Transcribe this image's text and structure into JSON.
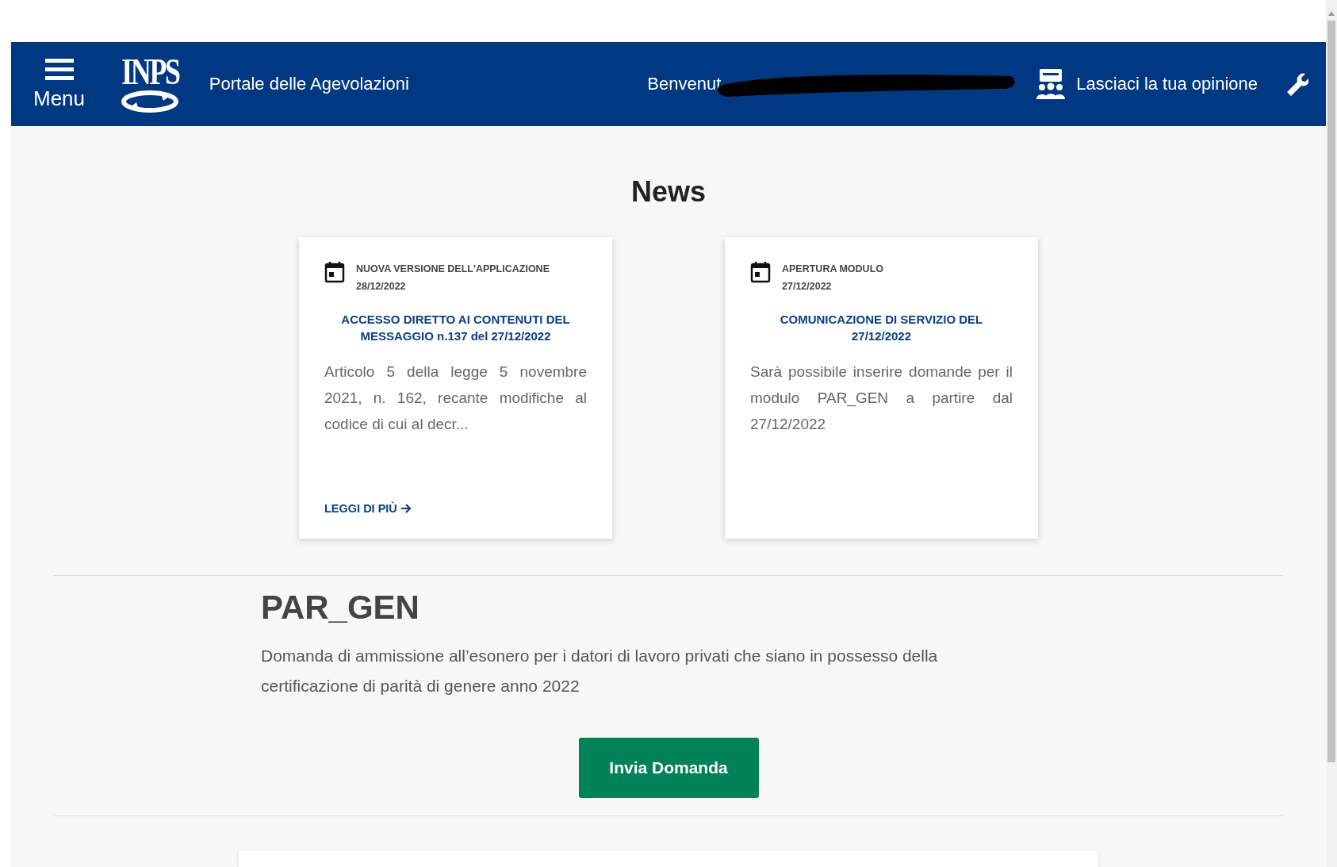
{
  "header": {
    "menu_label": "Menu",
    "logo_text": "INPS",
    "portal_title": "Portale delle Agevolazioni",
    "welcome": "Benvenut",
    "feedback": "Lasciaci la tua opinione"
  },
  "news": {
    "title": "News",
    "cards": [
      {
        "category": "NUOVA VERSIONE DELL'APPLICAZIONE",
        "date": "28/12/2022",
        "headline": "ACCESSO DIRETTO AI CONTENUTI DEL MESSAGGIO n.137 del 27/12/2022",
        "body": "Articolo 5 della legge 5 novembre 2021, n. 162, recante modifiche al codice di cui al decr...",
        "link": "LEGGI DI PIÙ"
      },
      {
        "category": "APERTURA MODULO",
        "date": "27/12/2022",
        "headline": "COMUNICAZIONE DI SERVIZIO DEL 27/12/2022",
        "body": "Sarà possibile inserire domande per il modulo PAR_GEN a partire dal 27/12/2022"
      }
    ]
  },
  "module": {
    "title": "PAR_GEN",
    "description": "Domanda di ammissione all’esonero per i datori di lavoro privati che siano in possesso della certificazione di parità di genere anno 2022",
    "button": "Invia Domanda"
  }
}
